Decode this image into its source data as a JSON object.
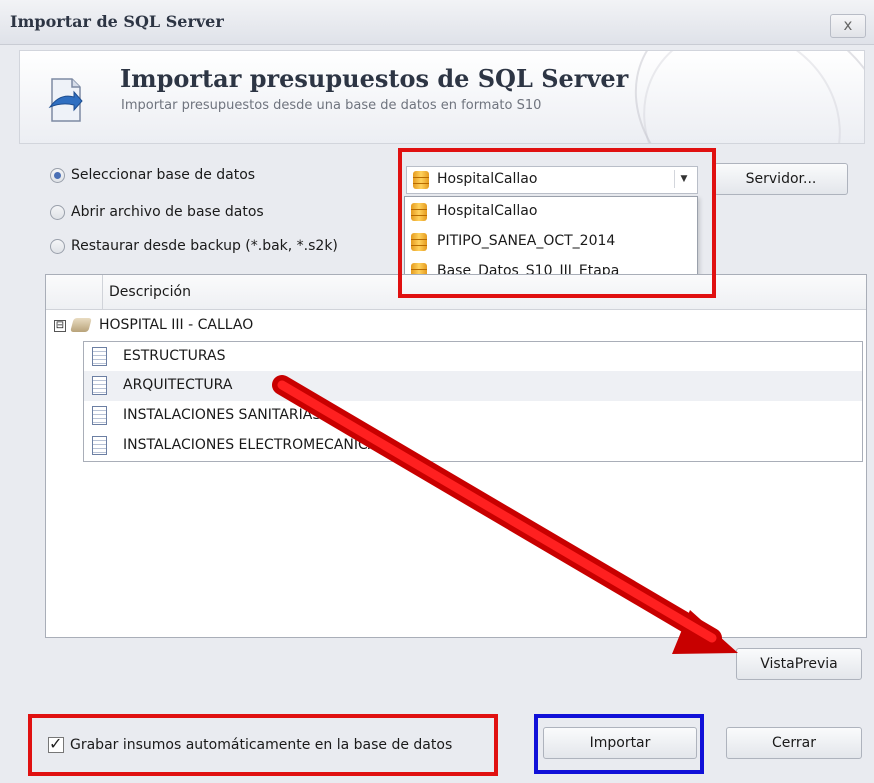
{
  "window": {
    "title": "Importar de SQL Server",
    "close_glyph": "x"
  },
  "header": {
    "title": "Importar presupuestos de SQL Server",
    "subtitle": "Importar presupuestos desde una base de datos en formato S10",
    "icon": "import-db-icon"
  },
  "source_options": [
    {
      "label": "Seleccionar base de datos",
      "selected": true
    },
    {
      "label": "Abrir archivo de base datos",
      "selected": false
    },
    {
      "label": "Restaurar desde backup (*.bak, *.s2k)",
      "selected": false
    }
  ],
  "database_combo": {
    "value": "HospitalCallao",
    "options": [
      "HospitalCallao",
      "PITIPO_SANEA_OCT_2014",
      "Base_Datos_S10_III_Etapa"
    ]
  },
  "server_button": {
    "label": "Servidor..."
  },
  "tree": {
    "column_header": "Descripción",
    "root": {
      "label": "HOSPITAL III - CALLAO",
      "expanded": true,
      "expander_glyph": "⊟"
    },
    "children": [
      {
        "label": "ESTRUCTURAS"
      },
      {
        "label": "ARQUITECTURA"
      },
      {
        "label": "INSTALACIONES SANITARIAS"
      },
      {
        "label": "INSTALACIONES ELECTROMECANICAS"
      }
    ]
  },
  "preview_button": {
    "label": "VistaPrevia"
  },
  "auto_save_checkbox": {
    "label": "Grabar insumos automáticamente en la base de datos",
    "checked": true
  },
  "import_button": {
    "label": "Importar"
  },
  "close_button": {
    "label": "Cerrar"
  },
  "annotation_colors": {
    "red": "#e01010",
    "blue": "#1010d8"
  }
}
